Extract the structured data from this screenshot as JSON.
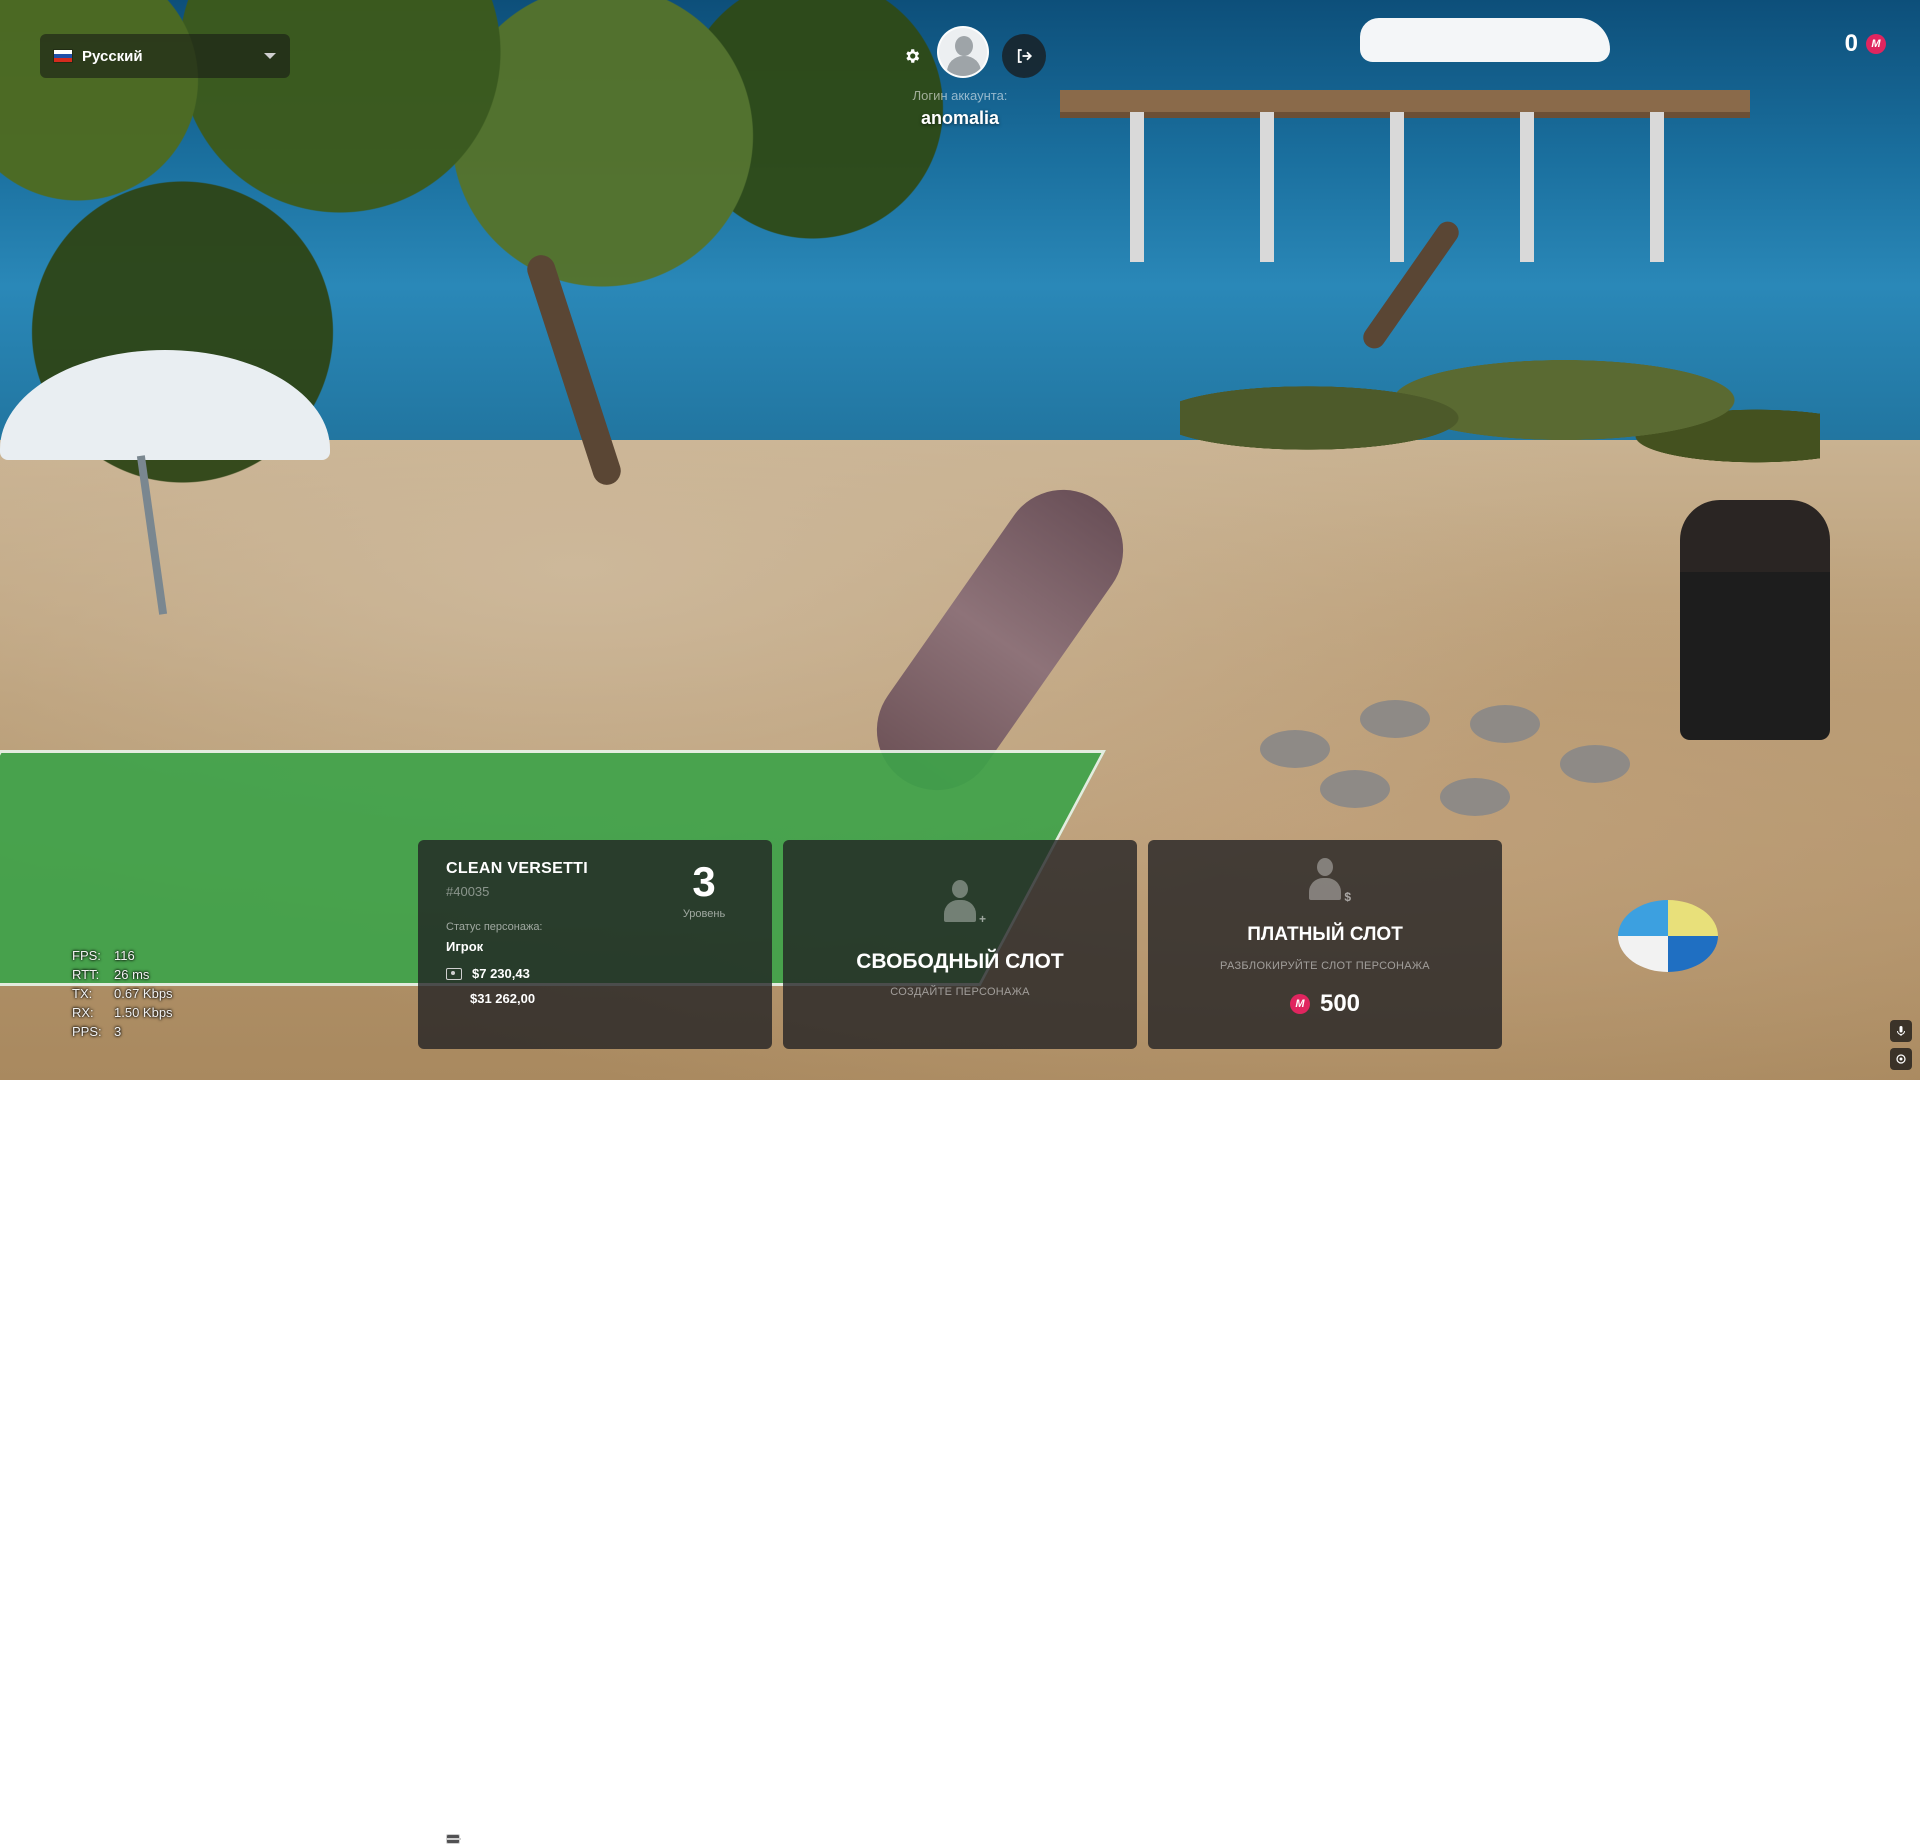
{
  "language": {
    "label": "Русский",
    "flag_colors": [
      "#ffffff",
      "#1f4fa8",
      "#d52b1e"
    ]
  },
  "account": {
    "login_caption": "Логин аккаунта:",
    "login": "anomalia",
    "settings_icon": "gear-icon",
    "logout_icon": "logout-icon",
    "avatar_icon": "user-silhouette-icon"
  },
  "balance": {
    "value": "0",
    "coin_symbol": "M",
    "coin_color": "#e0255f"
  },
  "characters": [
    {
      "name": "CLEAN VERSETTI",
      "id": "#40035",
      "level": "3",
      "level_label": "Уровень",
      "status_label": "Статус персонажа:",
      "status": "Игрок",
      "cash": "$7 230,43",
      "bank": "$31 262,00"
    }
  ],
  "free_slot": {
    "title": "СВОБОДНЫЙ СЛОТ",
    "subtitle": "СОЗДАЙТЕ ПЕРСОНАЖА",
    "icon": "add-user-icon"
  },
  "paid_slot": {
    "title": "ПЛАТНЫЙ СЛОТ",
    "subtitle": "РАЗБЛОКИРУЙТЕ СЛОТ ПЕРСОНАЖА",
    "price": "500",
    "coin_symbol": "M",
    "icon": "paid-user-icon"
  },
  "debug_stats": [
    {
      "key": "FPS:",
      "value": "116"
    },
    {
      "key": "RTT:",
      "value": "26 ms"
    },
    {
      "key": "TX:",
      "value": "0.67 Kbps"
    },
    {
      "key": "RX:",
      "value": "1.50 Kbps"
    },
    {
      "key": "PPS:",
      "value": "3"
    }
  ],
  "corner_controls": [
    "microphone-icon",
    "target-icon"
  ]
}
